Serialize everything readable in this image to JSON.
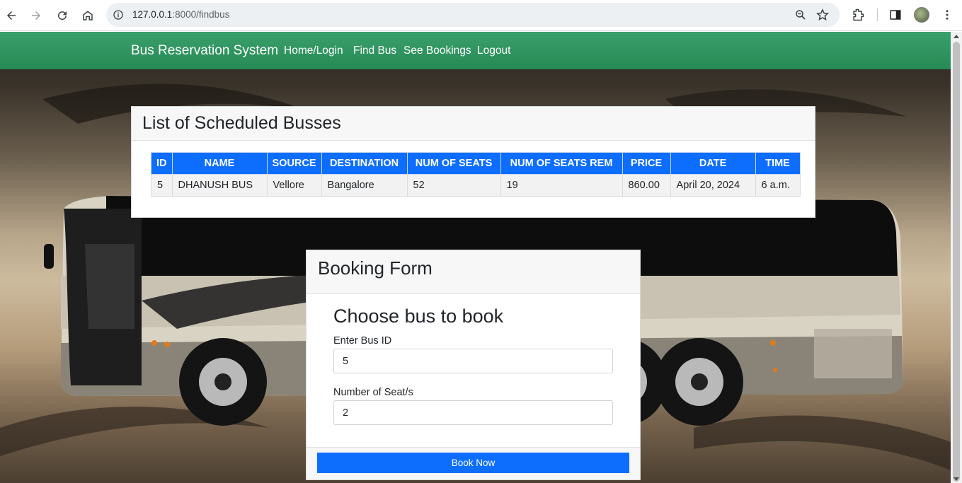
{
  "browser": {
    "url_host": "127.0.0.1",
    "url_rest": ":8000/findbus"
  },
  "navbar": {
    "brand": "Bus Reservation System",
    "links": [
      "Home/Login",
      "Find Bus",
      "See Bookings",
      "Logout"
    ]
  },
  "bus_list": {
    "title": "List of Scheduled Busses",
    "columns": [
      "ID",
      "NAME",
      "SOURCE",
      "DESTINATION",
      "NUM OF SEATS",
      "NUM OF SEATS REM",
      "PRICE",
      "DATE",
      "TIME"
    ],
    "rows": [
      [
        "5",
        "DHANUSH BUS",
        "Vellore",
        "Bangalore",
        "52",
        "19",
        "860.00",
        "April 20, 2024",
        "6 a.m."
      ]
    ]
  },
  "booking_form": {
    "title": "Booking Form",
    "subtitle": "Choose bus to book",
    "bus_id_label": "Enter Bus ID",
    "bus_id_value": "5",
    "seats_label": "Number of Seat/s",
    "seats_value": "2",
    "submit_label": "Book Now"
  },
  "colors": {
    "navbar": "#2e9660",
    "primary": "#0d6efd"
  }
}
